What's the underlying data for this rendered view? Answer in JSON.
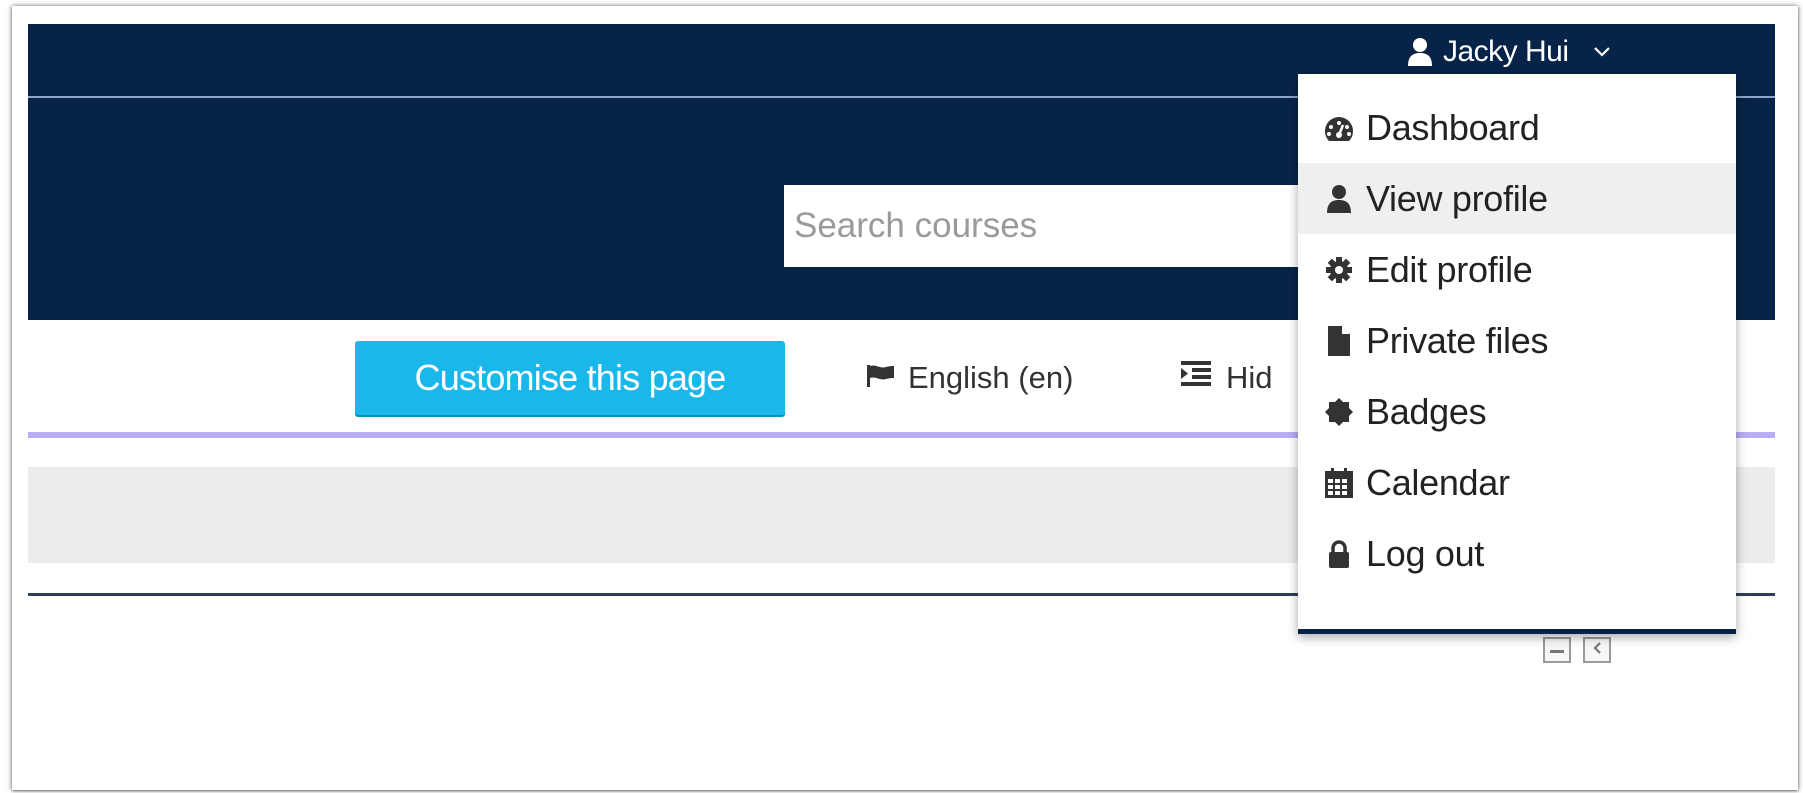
{
  "user_menu": {
    "name": "Jacky Hui",
    "icon": "user-icon",
    "caret_icon": "chevron-down-icon"
  },
  "search": {
    "placeholder": "Search courses"
  },
  "toolbar": {
    "customise_label": "Customise this page",
    "language_label": "English (en)",
    "language_icon": "flag-icon",
    "hide_blocks_label": "Hid",
    "hide_blocks_icon": "indent-icon"
  },
  "dropdown": {
    "items": [
      {
        "label": "Dashboard",
        "icon": "dashboard-icon"
      },
      {
        "label": "View profile",
        "icon": "user-icon",
        "highlighted": true
      },
      {
        "label": "Edit profile",
        "icon": "gear-icon"
      },
      {
        "label": "Private files",
        "icon": "file-icon"
      },
      {
        "label": "Badges",
        "icon": "badge-icon"
      },
      {
        "label": "Calendar",
        "icon": "calendar-icon"
      },
      {
        "label": "Log out",
        "icon": "lock-icon"
      }
    ]
  },
  "colors": {
    "navbar": "#072448",
    "button": "#1ab7ea",
    "accent_rule": "#b9adf3",
    "band": "#ececee"
  }
}
